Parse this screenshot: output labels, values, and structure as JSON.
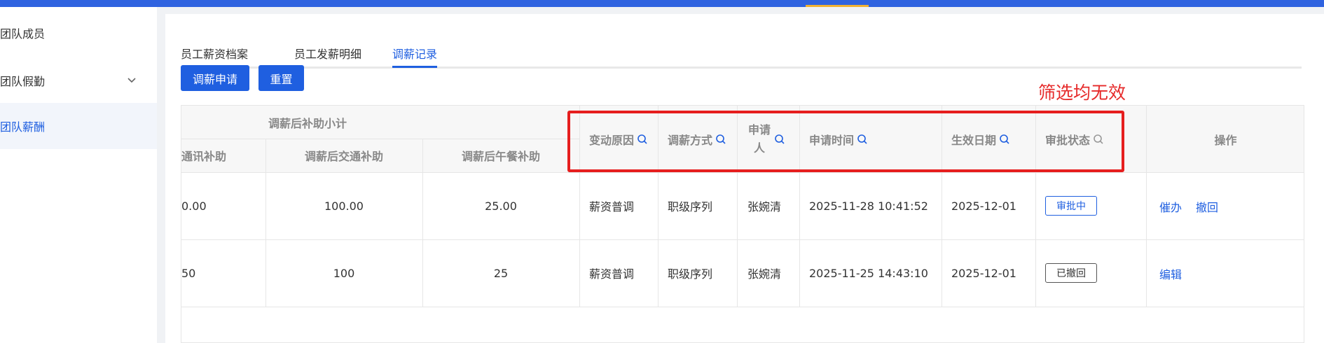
{
  "sidebar": {
    "items": [
      {
        "label": "团队成员"
      },
      {
        "label": "团队假勤"
      },
      {
        "label": "团队薪酬"
      }
    ]
  },
  "tabs": [
    {
      "label": "员工薪资档案"
    },
    {
      "label": "员工发薪明细"
    },
    {
      "label": "调薪记录"
    }
  ],
  "toolbar": {
    "apply_label": "调薪申请",
    "reset_label": "重置"
  },
  "annotation": "筛选均无效",
  "table": {
    "group_header": "调薪后补助小计",
    "columns": {
      "telecom": "通讯补助",
      "transport": "调薪后交通补助",
      "meal": "调薪后午餐补助",
      "reason": "变动原因",
      "method": "调薪方式",
      "applicant": "申请人",
      "apply_time": "申请时间",
      "effective": "生效日期",
      "status": "审批状态",
      "actions": "操作"
    },
    "rows": [
      {
        "telecom": "0.00",
        "transport": "100.00",
        "meal": "25.00",
        "reason": "薪资普调",
        "method": "职级序列",
        "applicant": "张婉清",
        "apply_time": "2025-11-28 10:41:52",
        "effective": "2025-12-01",
        "status": "审批中",
        "actions": [
          "催办",
          "撤回"
        ]
      },
      {
        "telecom": "50",
        "transport": "100",
        "meal": "25",
        "reason": "薪资普调",
        "method": "职级序列",
        "applicant": "张婉清",
        "apply_time": "2025-11-25 14:43:10",
        "effective": "2025-12-01",
        "status": "已撤回",
        "actions": [
          "编辑"
        ]
      }
    ]
  },
  "colors": {
    "primary": "#1f5fe0",
    "annotation": "#e62a2a",
    "topbar": "#2f63e0"
  }
}
